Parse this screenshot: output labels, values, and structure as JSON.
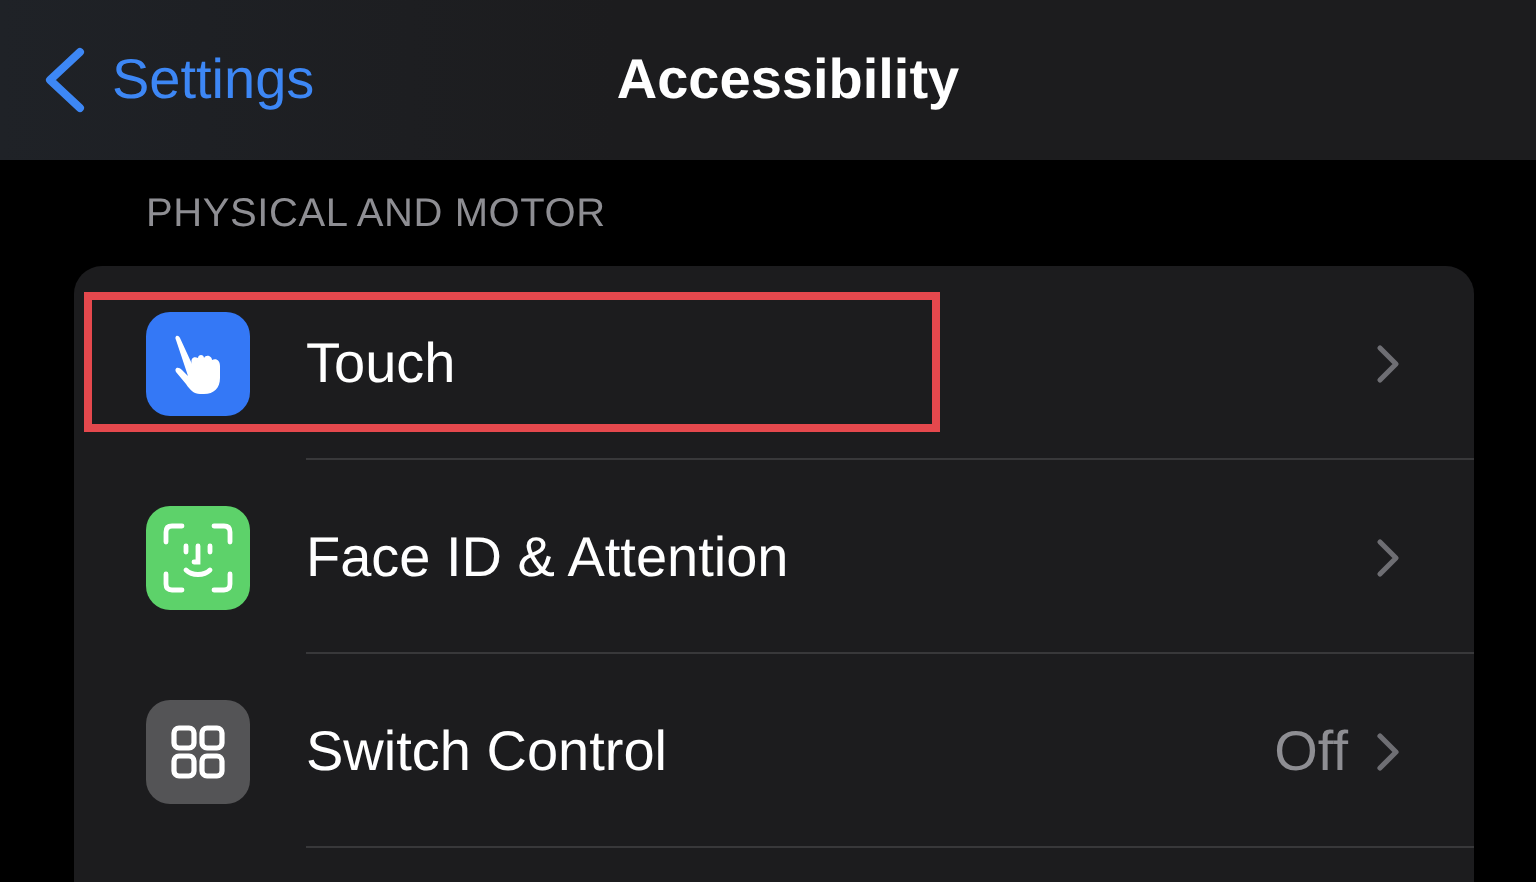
{
  "nav": {
    "back_label": "Settings",
    "title": "Accessibility"
  },
  "section": {
    "header": "PHYSICAL AND MOTOR",
    "rows": [
      {
        "kind": "touch",
        "label": "Touch",
        "highlighted": true
      },
      {
        "kind": "face",
        "label": "Face ID & Attention",
        "highlighted": false
      },
      {
        "kind": "switch",
        "label": "Switch Control",
        "value": "Off",
        "highlighted": false
      }
    ]
  }
}
